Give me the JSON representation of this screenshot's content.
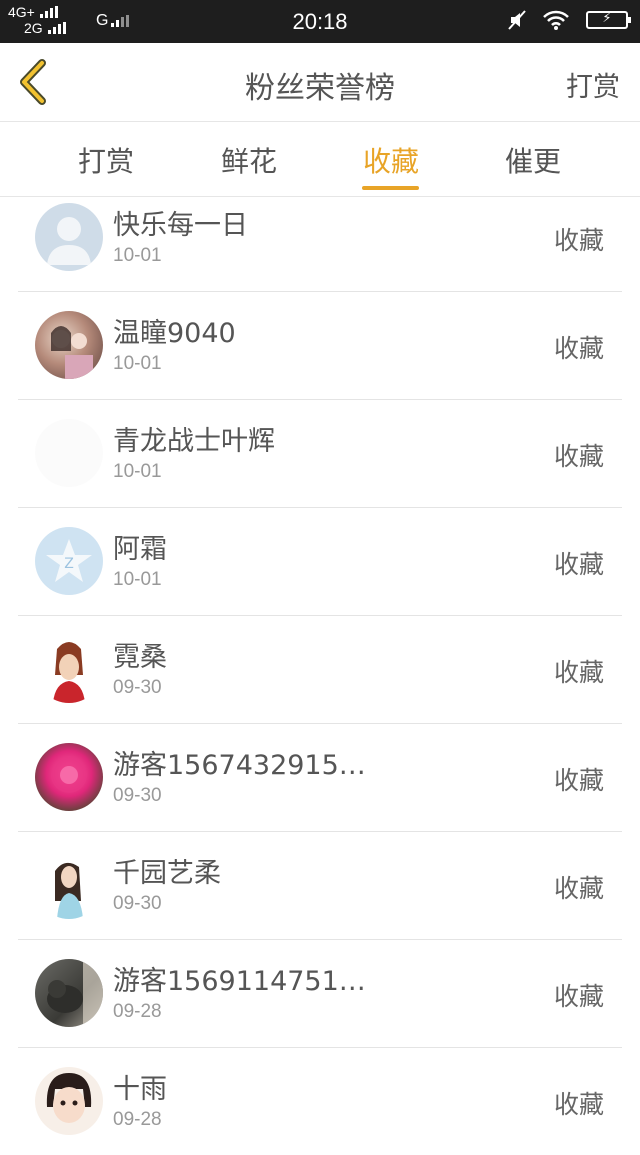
{
  "status_bar": {
    "net1": "4G+",
    "net2": "2G",
    "net3": "G",
    "time": "20:18"
  },
  "header": {
    "title": "粉丝荣誉榜",
    "right_action": "打赏"
  },
  "tabs": [
    {
      "label": "打赏"
    },
    {
      "label": "鲜花"
    },
    {
      "label": "收藏",
      "active": true
    },
    {
      "label": "催更"
    }
  ],
  "colors": {
    "accent": "#e8a427",
    "status_bar_bg": "#1e1e1e"
  },
  "list": [
    {
      "name": "快乐每一日",
      "date": "10-01",
      "action": "收藏",
      "avatar": "default-user-avatar"
    },
    {
      "name": "温瞳9040",
      "date": "10-01",
      "action": "收藏",
      "avatar": "photo-avatar"
    },
    {
      "name": "青龙战士叶辉",
      "date": "10-01",
      "action": "收藏",
      "avatar": "blank-avatar"
    },
    {
      "name": "阿霜",
      "date": "10-01",
      "action": "收藏",
      "avatar": "qzone-star-avatar"
    },
    {
      "name": "霓桑",
      "date": "09-30",
      "action": "收藏",
      "avatar": "costume-girl-avatar"
    },
    {
      "name": "游客1567432915…",
      "date": "09-30",
      "action": "收藏",
      "avatar": "flower-avatar"
    },
    {
      "name": "千园艺柔",
      "date": "09-30",
      "action": "收藏",
      "avatar": "girl-photo-avatar"
    },
    {
      "name": "游客1569114751…",
      "date": "09-28",
      "action": "收藏",
      "avatar": "cat-photo-avatar"
    },
    {
      "name": "十雨",
      "date": "09-28",
      "action": "收藏",
      "avatar": "cartoon-girl-avatar"
    }
  ]
}
